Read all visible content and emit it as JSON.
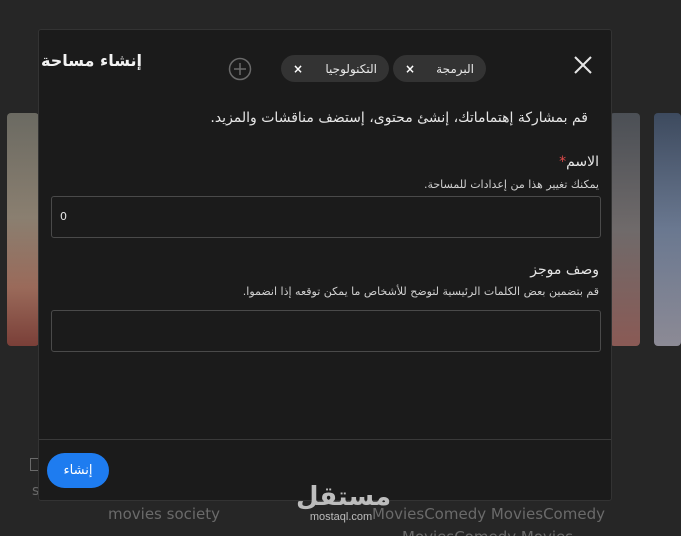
{
  "background": {
    "text_1": "movies society",
    "text_2": "MoviesComedy MoviesComedy",
    "text_3": "MoviesComedy Movies",
    "fragment": "s"
  },
  "watermark": {
    "arabic": "مستقل",
    "latin": "mostaql.com"
  },
  "modal": {
    "title": "إنشاء مساحة",
    "tags": [
      {
        "label": "البرمجة",
        "remove": "×"
      },
      {
        "label": "التكنولوجيا",
        "remove": "×"
      }
    ],
    "intro": "قم بمشاركة إهتماماتك، إنشئ محتوى، إستضف مناقشات والمزيد.",
    "name_field": {
      "label": "الاسم",
      "required_mark": "*",
      "hint": "يمكنك تغيير هذا من إعدادات للمساحة.",
      "value": "0"
    },
    "description_field": {
      "label": "وصف موجز",
      "hint": "قم بتضمين بعض الكلمات الرئيسية لتوضح للأشخاص ما يمكن توقعه إذا انضموا.",
      "value": ""
    },
    "create_button": "إنشاء"
  },
  "icons": {
    "close": "close-icon",
    "add": "plus-circle-icon"
  },
  "colors": {
    "accent": "#1e7cf0",
    "required": "#e04a4a",
    "modal_bg": "#1b1b1b"
  }
}
